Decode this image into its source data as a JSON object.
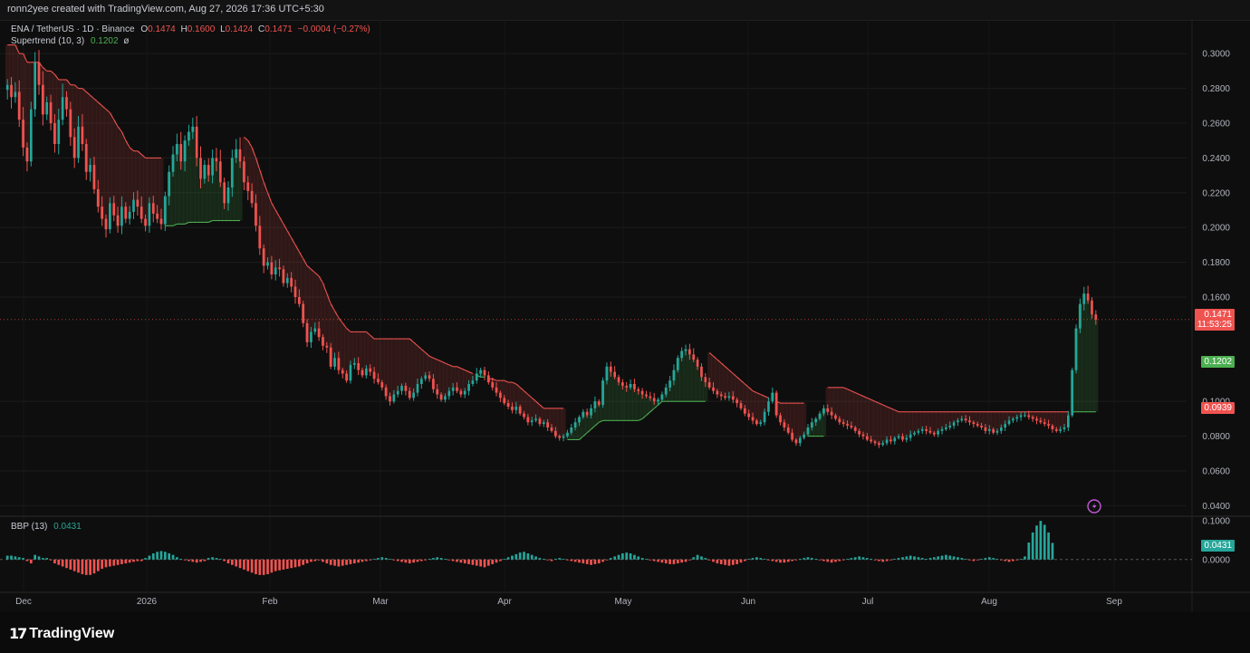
{
  "header": {
    "caption": "ronn2yee created with TradingView.com, Aug 27, 2026 17:36 UTC+5:30"
  },
  "legend": {
    "symbol": "ENA / TetherUS · 1D · Binance",
    "o_label": "O",
    "o_value": "0.1474",
    "h_label": "H",
    "h_value": "0.1600",
    "l_label": "L",
    "l_value": "0.1424",
    "c_label": "C",
    "c_value": "0.1471",
    "change": "−0.0004 (−0.27%)",
    "indicator_name": "Supertrend (10, 3)",
    "indicator_value": "0.1202",
    "indicator_extra": "ø",
    "bbp_name": "BBP (13)",
    "bbp_value": "0.0431"
  },
  "price_axis": {
    "ticks": [
      "0.3000",
      "0.2800",
      "0.2600",
      "0.2400",
      "0.2200",
      "0.2000",
      "0.1800",
      "0.1600",
      "0.1000",
      "0.0800",
      "0.0600",
      "0.0400"
    ],
    "tick_values": [
      0.3,
      0.28,
      0.26,
      0.24,
      0.22,
      0.2,
      0.18,
      0.16,
      0.1,
      0.08,
      0.06,
      0.04
    ],
    "last_price": "0.1471",
    "countdown": "11:53:25",
    "supertrend_tag": "0.1202",
    "resistance_tag": "0.0939"
  },
  "bbp_axis": {
    "ticks": [
      "0.1000",
      "0.0000"
    ],
    "tick_values": [
      0.1,
      0.0
    ],
    "last_value_tag": "0.0431"
  },
  "time_axis": {
    "labels": [
      "Dec",
      "2026",
      "Feb",
      "Mar",
      "Apr",
      "May",
      "Jun",
      "Jul",
      "Aug",
      "Sep"
    ]
  },
  "branding": {
    "logo_text": "TradingView"
  },
  "colors": {
    "up": "#26a69a",
    "down": "#ef5350",
    "supertrend_down": "#ef5350",
    "supertrend_up": "#4caf50",
    "background": "#0e0e0e",
    "grid": "#1c1c1c"
  },
  "icons": {
    "alert": "lightning-circle-icon"
  },
  "chart_data": {
    "type": "candlestick",
    "symbol": "ENA / TetherUS",
    "interval": "1D",
    "y_range": [
      0.035,
      0.31
    ],
    "closes": [
      0.282,
      0.275,
      0.278,
      0.262,
      0.246,
      0.238,
      0.268,
      0.295,
      0.282,
      0.265,
      0.272,
      0.26,
      0.248,
      0.262,
      0.275,
      0.268,
      0.252,
      0.24,
      0.258,
      0.248,
      0.232,
      0.236,
      0.222,
      0.212,
      0.205,
      0.199,
      0.214,
      0.207,
      0.201,
      0.212,
      0.205,
      0.209,
      0.216,
      0.212,
      0.205,
      0.201,
      0.214,
      0.208,
      0.205,
      0.202,
      0.218,
      0.232,
      0.242,
      0.248,
      0.238,
      0.25,
      0.255,
      0.258,
      0.24,
      0.228,
      0.236,
      0.23,
      0.24,
      0.238,
      0.226,
      0.214,
      0.223,
      0.24,
      0.245,
      0.238,
      0.226,
      0.221,
      0.214,
      0.201,
      0.188,
      0.178,
      0.18,
      0.173,
      0.177,
      0.176,
      0.168,
      0.171,
      0.166,
      0.16,
      0.156,
      0.145,
      0.134,
      0.14,
      0.142,
      0.137,
      0.132,
      0.131,
      0.12,
      0.125,
      0.118,
      0.116,
      0.112,
      0.121,
      0.122,
      0.118,
      0.115,
      0.119,
      0.117,
      0.113,
      0.111,
      0.108,
      0.103,
      0.1,
      0.104,
      0.106,
      0.109,
      0.106,
      0.102,
      0.105,
      0.11,
      0.113,
      0.115,
      0.113,
      0.107,
      0.104,
      0.101,
      0.103,
      0.106,
      0.108,
      0.106,
      0.104,
      0.106,
      0.11,
      0.112,
      0.116,
      0.118,
      0.115,
      0.111,
      0.108,
      0.105,
      0.102,
      0.099,
      0.097,
      0.095,
      0.097,
      0.093,
      0.091,
      0.088,
      0.089,
      0.09,
      0.087,
      0.088,
      0.085,
      0.083,
      0.08,
      0.079,
      0.08,
      0.082,
      0.085,
      0.088,
      0.091,
      0.094,
      0.092,
      0.096,
      0.1,
      0.098,
      0.112,
      0.12,
      0.117,
      0.114,
      0.111,
      0.109,
      0.108,
      0.11,
      0.107,
      0.106,
      0.104,
      0.103,
      0.102,
      0.1,
      0.101,
      0.104,
      0.108,
      0.112,
      0.118,
      0.125,
      0.129,
      0.13,
      0.127,
      0.124,
      0.12,
      0.114,
      0.111,
      0.108,
      0.106,
      0.104,
      0.103,
      0.102,
      0.103,
      0.101,
      0.099,
      0.096,
      0.093,
      0.091,
      0.089,
      0.087,
      0.088,
      0.094,
      0.1,
      0.105,
      0.092,
      0.088,
      0.085,
      0.082,
      0.078,
      0.076,
      0.079,
      0.081,
      0.085,
      0.088,
      0.09,
      0.093,
      0.096,
      0.094,
      0.092,
      0.09,
      0.088,
      0.087,
      0.086,
      0.085,
      0.083,
      0.081,
      0.08,
      0.078,
      0.077,
      0.076,
      0.075,
      0.076,
      0.078,
      0.077,
      0.079,
      0.08,
      0.078,
      0.079,
      0.081,
      0.082,
      0.083,
      0.084,
      0.083,
      0.082,
      0.081,
      0.083,
      0.084,
      0.085,
      0.086,
      0.088,
      0.089,
      0.09,
      0.089,
      0.088,
      0.087,
      0.086,
      0.085,
      0.083,
      0.084,
      0.082,
      0.083,
      0.085,
      0.087,
      0.089,
      0.09,
      0.091,
      0.092,
      0.092,
      0.091,
      0.09,
      0.089,
      0.088,
      0.087,
      0.086,
      0.084,
      0.083,
      0.084,
      0.085,
      0.092,
      0.118,
      0.142,
      0.156,
      0.162,
      0.158,
      0.15,
      0.147
    ],
    "supertrend": [
      0.305,
      0.305,
      0.305,
      0.3,
      0.3,
      0.295,
      0.295,
      0.295,
      0.295,
      0.292,
      0.29,
      0.29,
      0.288,
      0.285,
      0.285,
      0.285,
      0.282,
      0.282,
      0.28,
      0.28,
      0.278,
      0.276,
      0.274,
      0.272,
      0.27,
      0.268,
      0.266,
      0.262,
      0.258,
      0.255,
      0.25,
      0.246,
      0.244,
      0.244,
      0.242,
      0.24,
      0.24,
      0.24,
      0.24,
      0.24,
      0.201,
      0.201,
      0.201,
      0.202,
      0.202,
      0.202,
      0.203,
      0.203,
      0.203,
      0.203,
      0.203,
      0.203,
      0.204,
      0.204,
      0.204,
      0.204,
      0.204,
      0.204,
      0.204,
      0.204,
      0.252,
      0.25,
      0.246,
      0.24,
      0.233,
      0.226,
      0.22,
      0.214,
      0.21,
      0.206,
      0.202,
      0.198,
      0.194,
      0.19,
      0.186,
      0.182,
      0.178,
      0.176,
      0.174,
      0.172,
      0.168,
      0.162,
      0.156,
      0.152,
      0.148,
      0.145,
      0.142,
      0.14,
      0.14,
      0.14,
      0.14,
      0.14,
      0.138,
      0.136,
      0.136,
      0.136,
      0.136,
      0.136,
      0.136,
      0.136,
      0.136,
      0.136,
      0.136,
      0.134,
      0.132,
      0.13,
      0.128,
      0.126,
      0.125,
      0.124,
      0.123,
      0.122,
      0.121,
      0.12,
      0.12,
      0.119,
      0.118,
      0.117,
      0.116,
      0.115,
      0.114,
      0.114,
      0.113,
      0.113,
      0.112,
      0.112,
      0.112,
      0.111,
      0.111,
      0.11,
      0.108,
      0.106,
      0.104,
      0.102,
      0.1,
      0.098,
      0.096,
      0.096,
      0.096,
      0.096,
      0.096,
      0.096,
      0.078,
      0.078,
      0.078,
      0.078,
      0.08,
      0.082,
      0.084,
      0.086,
      0.088,
      0.089,
      0.089,
      0.089,
      0.089,
      0.089,
      0.089,
      0.089,
      0.089,
      0.089,
      0.089,
      0.09,
      0.092,
      0.094,
      0.096,
      0.098,
      0.1,
      0.1,
      0.1,
      0.1,
      0.1,
      0.1,
      0.1,
      0.1,
      0.1,
      0.1,
      0.1,
      0.1,
      0.128,
      0.126,
      0.124,
      0.122,
      0.12,
      0.118,
      0.116,
      0.114,
      0.112,
      0.11,
      0.108,
      0.106,
      0.105,
      0.104,
      0.103,
      0.102,
      0.101,
      0.1,
      0.099,
      0.099,
      0.099,
      0.099,
      0.099,
      0.099,
      0.099,
      0.08,
      0.08,
      0.08,
      0.08,
      0.08,
      0.108,
      0.108,
      0.108,
      0.108,
      0.108,
      0.107,
      0.106,
      0.105,
      0.104,
      0.103,
      0.102,
      0.101,
      0.1,
      0.099,
      0.098,
      0.097,
      0.096,
      0.095,
      0.094,
      0.094,
      0.094,
      0.094,
      0.094,
      0.094,
      0.094,
      0.094,
      0.094,
      0.094,
      0.094,
      0.094,
      0.094,
      0.094,
      0.094,
      0.094,
      0.094,
      0.094,
      0.094,
      0.094,
      0.094,
      0.094,
      0.094,
      0.094,
      0.094,
      0.094,
      0.094,
      0.094,
      0.094,
      0.094,
      0.094,
      0.094,
      0.094,
      0.094,
      0.094,
      0.094,
      0.094,
      0.094,
      0.094,
      0.094,
      0.094,
      0.094,
      0.094,
      0.094,
      0.094,
      0.094,
      0.094,
      0.094,
      0.094,
      0.094,
      0.094,
      0.094,
      0.094,
      0.094,
      0.094,
      0.094,
      0.094,
      0.094,
      0.094,
      0.094,
      0.094,
      0.094,
      0.088,
      0.104,
      0.12,
      0.12,
      0.12,
      0.12
    ],
    "bbp": [
      0.01,
      0.01,
      0.008,
      0.006,
      0.004,
      -0.004,
      -0.01,
      0.012,
      0.008,
      0.004,
      0.004,
      -0.002,
      -0.01,
      -0.014,
      -0.018,
      -0.022,
      -0.026,
      -0.03,
      -0.034,
      -0.038,
      -0.04,
      -0.04,
      -0.036,
      -0.03,
      -0.024,
      -0.02,
      -0.018,
      -0.016,
      -0.014,
      -0.012,
      -0.01,
      -0.008,
      -0.006,
      -0.004,
      -0.004,
      0.004,
      0.01,
      0.016,
      0.02,
      0.022,
      0.02,
      0.016,
      0.012,
      0.006,
      0.002,
      -0.002,
      -0.004,
      -0.006,
      -0.008,
      -0.006,
      -0.004,
      0.004,
      0.006,
      0.004,
      0.002,
      -0.004,
      -0.01,
      -0.014,
      -0.018,
      -0.022,
      -0.026,
      -0.03,
      -0.034,
      -0.038,
      -0.04,
      -0.04,
      -0.038,
      -0.034,
      -0.03,
      -0.028,
      -0.026,
      -0.024,
      -0.022,
      -0.02,
      -0.018,
      -0.014,
      -0.01,
      -0.006,
      -0.004,
      -0.002,
      -0.006,
      -0.01,
      -0.014,
      -0.016,
      -0.018,
      -0.016,
      -0.014,
      -0.012,
      -0.01,
      -0.008,
      -0.006,
      -0.004,
      -0.002,
      0.002,
      0.004,
      0.006,
      0.004,
      0.002,
      -0.002,
      -0.004,
      -0.006,
      -0.008,
      -0.01,
      -0.008,
      -0.006,
      -0.004,
      -0.002,
      0.002,
      0.004,
      0.006,
      0.004,
      0.002,
      -0.002,
      -0.004,
      -0.006,
      -0.008,
      -0.01,
      -0.012,
      -0.014,
      -0.016,
      -0.018,
      -0.02,
      -0.016,
      -0.012,
      -0.008,
      -0.004,
      0.002,
      0.006,
      0.01,
      0.014,
      0.018,
      0.02,
      0.016,
      0.012,
      0.008,
      0.004,
      0.002,
      -0.002,
      -0.004,
      0.002,
      0.004,
      0.002,
      -0.002,
      -0.004,
      -0.006,
      -0.008,
      -0.01,
      -0.012,
      -0.014,
      -0.012,
      -0.01,
      -0.006,
      -0.002,
      0.004,
      0.008,
      0.012,
      0.016,
      0.018,
      0.016,
      0.012,
      0.008,
      0.004,
      0.002,
      -0.002,
      -0.004,
      -0.006,
      -0.008,
      -0.01,
      -0.012,
      -0.012,
      -0.01,
      -0.008,
      -0.006,
      -0.002,
      0.006,
      0.012,
      0.008,
      0.004,
      -0.002,
      -0.006,
      -0.01,
      -0.012,
      -0.014,
      -0.016,
      -0.014,
      -0.012,
      -0.008,
      -0.004,
      0.002,
      0.004,
      0.006,
      0.004,
      0.002,
      -0.002,
      -0.004,
      -0.006,
      -0.008,
      -0.008,
      -0.006,
      -0.004,
      -0.002,
      0.002,
      0.004,
      0.006,
      0.004,
      0.002,
      -0.002,
      -0.004,
      -0.006,
      -0.008,
      -0.006,
      -0.004,
      -0.002,
      0.002,
      0.004,
      0.006,
      0.008,
      0.006,
      0.004,
      0.002,
      -0.002,
      -0.004,
      -0.006,
      -0.004,
      -0.002,
      0.002,
      0.004,
      0.006,
      0.008,
      0.01,
      0.008,
      0.006,
      0.004,
      0.002,
      0.004,
      0.006,
      0.008,
      0.01,
      0.012,
      0.01,
      0.008,
      0.006,
      0.004,
      0.002,
      -0.002,
      -0.004,
      -0.002,
      0.002,
      0.004,
      0.006,
      0.004,
      0.002,
      -0.002,
      -0.004,
      -0.006,
      -0.004,
      -0.002,
      0.002,
      0.008,
      0.044,
      0.07,
      0.088,
      0.1,
      0.09,
      0.07,
      0.043
    ]
  }
}
